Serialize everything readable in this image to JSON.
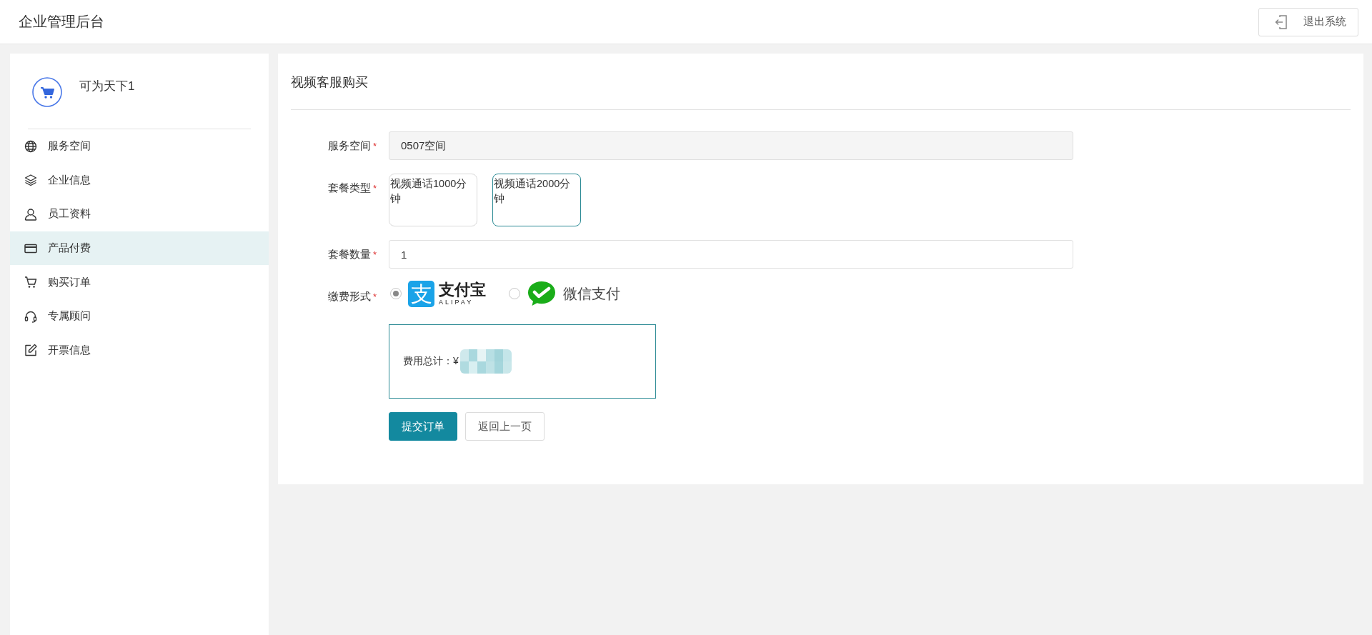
{
  "header": {
    "title": "企业管理后台",
    "logout_button": "退出系统"
  },
  "sidebar": {
    "account_name": "可为天下1",
    "items": [
      {
        "label": "服务空间",
        "kind": "globe",
        "selected": false
      },
      {
        "label": "企业信息",
        "kind": "layers",
        "selected": false
      },
      {
        "label": "员工资料",
        "kind": "user",
        "selected": false
      },
      {
        "label": "产品付费",
        "kind": "card",
        "selected": true
      },
      {
        "label": "购买订单",
        "kind": "cart",
        "selected": false
      },
      {
        "label": "专属顾问",
        "kind": "headset",
        "selected": false
      },
      {
        "label": "开票信息",
        "kind": "edit",
        "selected": false
      }
    ]
  },
  "page": {
    "title": "视频客服购买",
    "fields": [
      {
        "kind": "readonly",
        "label": "服务空间",
        "mark": "*",
        "value": "0507空间"
      },
      {
        "kind": "packages",
        "label": "套餐类型",
        "mark": "*",
        "options": [
          {
            "label": "视频通话1000分钟",
            "selected": false
          },
          {
            "label": "视频通话2000分钟",
            "selected": true
          }
        ]
      },
      {
        "kind": "input",
        "label": "套餐数量",
        "mark": "*",
        "value": "1"
      },
      {
        "kind": "payment",
        "label": "缴费形式",
        "mark": "*",
        "options": [
          {
            "kind": "alipay",
            "glyph": "支",
            "label": "支付宝",
            "sub_label": "ALIPAY",
            "selected": true
          },
          {
            "kind": "wechat",
            "label": "微信支付",
            "selected": false
          }
        ]
      }
    ],
    "total": {
      "label": "费用总计：¥"
    },
    "buttons": [
      {
        "label": "提交订单",
        "kind": "primary"
      },
      {
        "label": "返回上一页",
        "kind": "default"
      }
    ]
  }
}
